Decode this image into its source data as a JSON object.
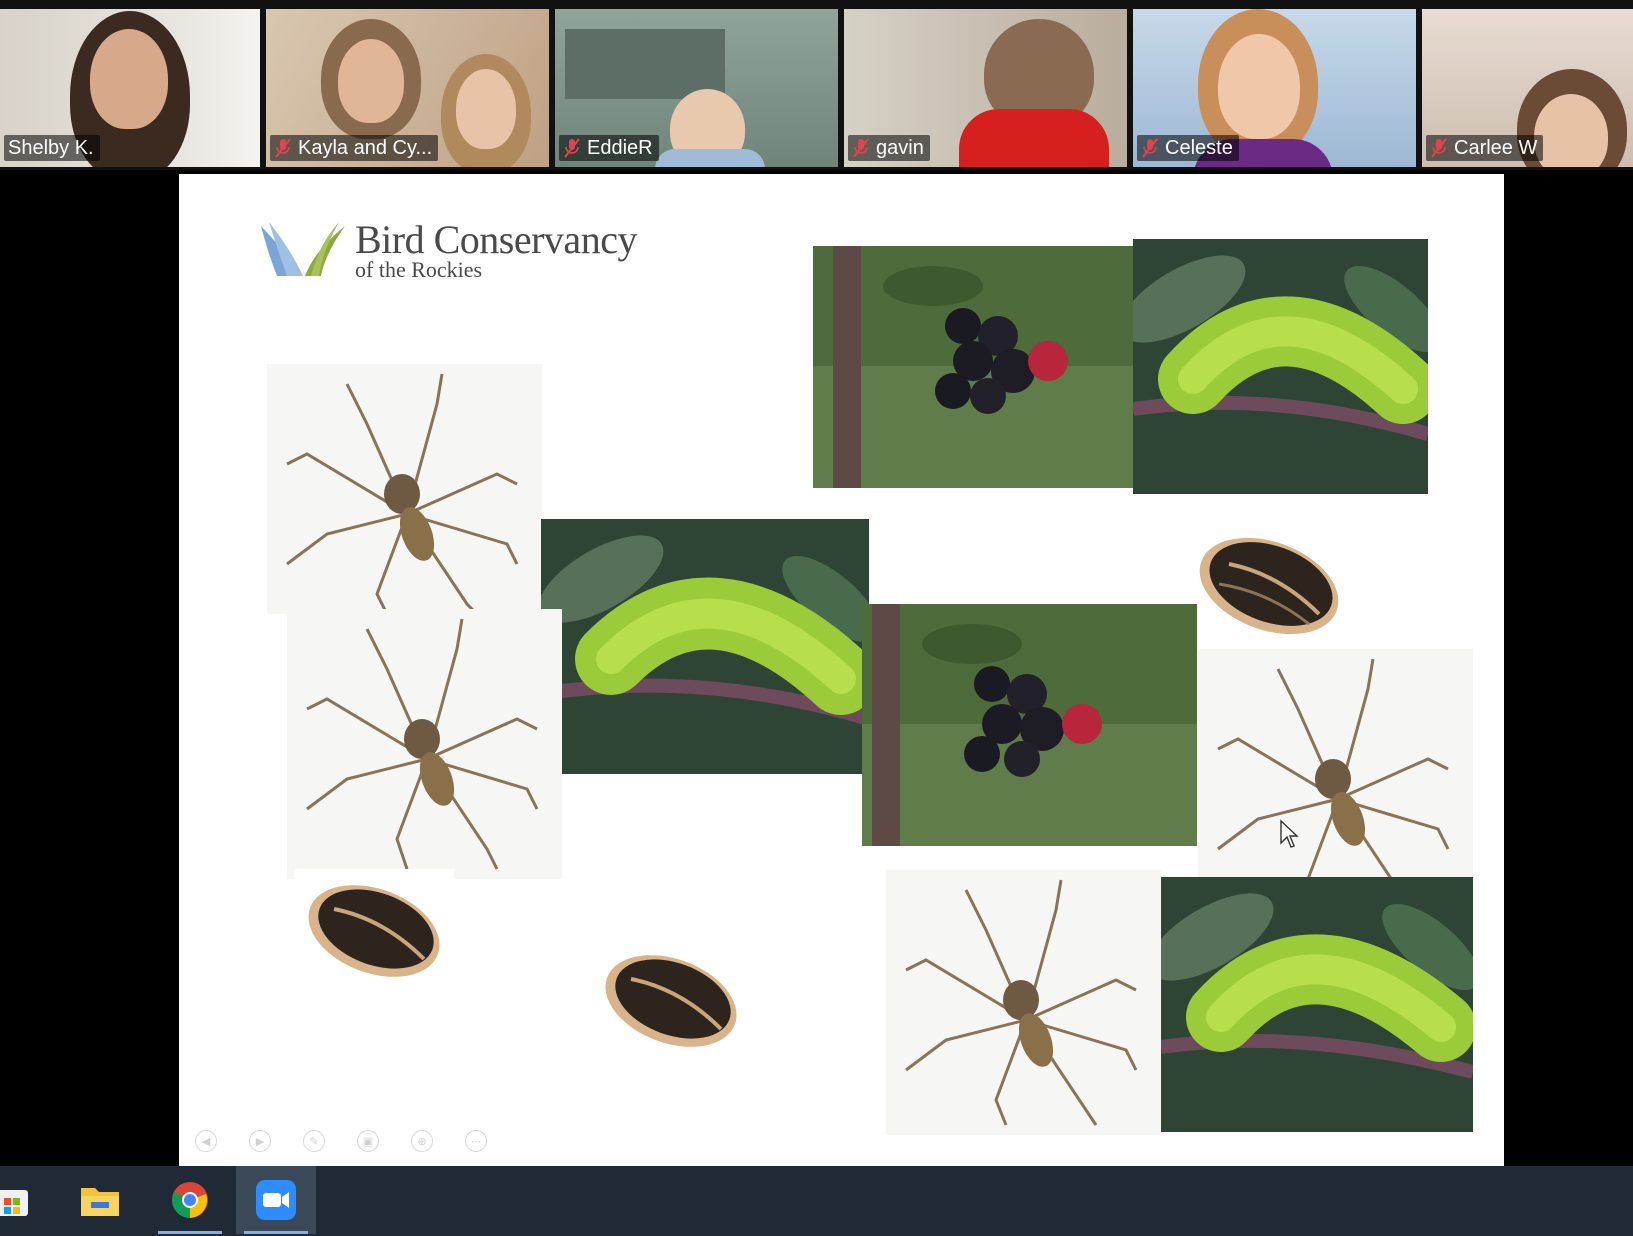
{
  "participants": [
    {
      "name": "Shelby K.",
      "muted": false
    },
    {
      "name": "Kayla and Cy...",
      "muted": true
    },
    {
      "name": "EddieR",
      "muted": true
    },
    {
      "name": "gavin",
      "muted": true
    },
    {
      "name": "Celeste",
      "muted": true
    },
    {
      "name": "Carlee W",
      "muted": true
    }
  ],
  "slide": {
    "logo_line1": "Bird Conservancy",
    "logo_line2": "of the Rockies",
    "images": [
      {
        "name": "blackberries",
        "kind": "berries"
      },
      {
        "name": "caterpillar",
        "kind": "caterpillar"
      },
      {
        "name": "spider",
        "kind": "spider"
      },
      {
        "name": "caterpillar",
        "kind": "caterpillar"
      },
      {
        "name": "sunflower-seed",
        "kind": "seed"
      },
      {
        "name": "spider",
        "kind": "spider"
      },
      {
        "name": "blackberries",
        "kind": "berries"
      },
      {
        "name": "spider",
        "kind": "spider"
      },
      {
        "name": "sunflower-seed",
        "kind": "seed"
      },
      {
        "name": "sunflower-seed",
        "kind": "seed"
      },
      {
        "name": "spider",
        "kind": "spider"
      },
      {
        "name": "caterpillar",
        "kind": "caterpillar"
      }
    ],
    "toolbar": [
      "prev-icon",
      "next-icon",
      "pen-icon",
      "screen-icon",
      "zoom-icon",
      "more-icon"
    ]
  },
  "taskbar": {
    "items": [
      "store-icon",
      "file-explorer-icon",
      "chrome-icon",
      "zoom-app-icon"
    ],
    "active": "zoom-app-icon"
  },
  "colors": {
    "mic_muted": "#e0444f",
    "logo_blue": "#7aa6d6",
    "logo_green": "#8cab3c",
    "taskbar": "#1f2a36"
  }
}
